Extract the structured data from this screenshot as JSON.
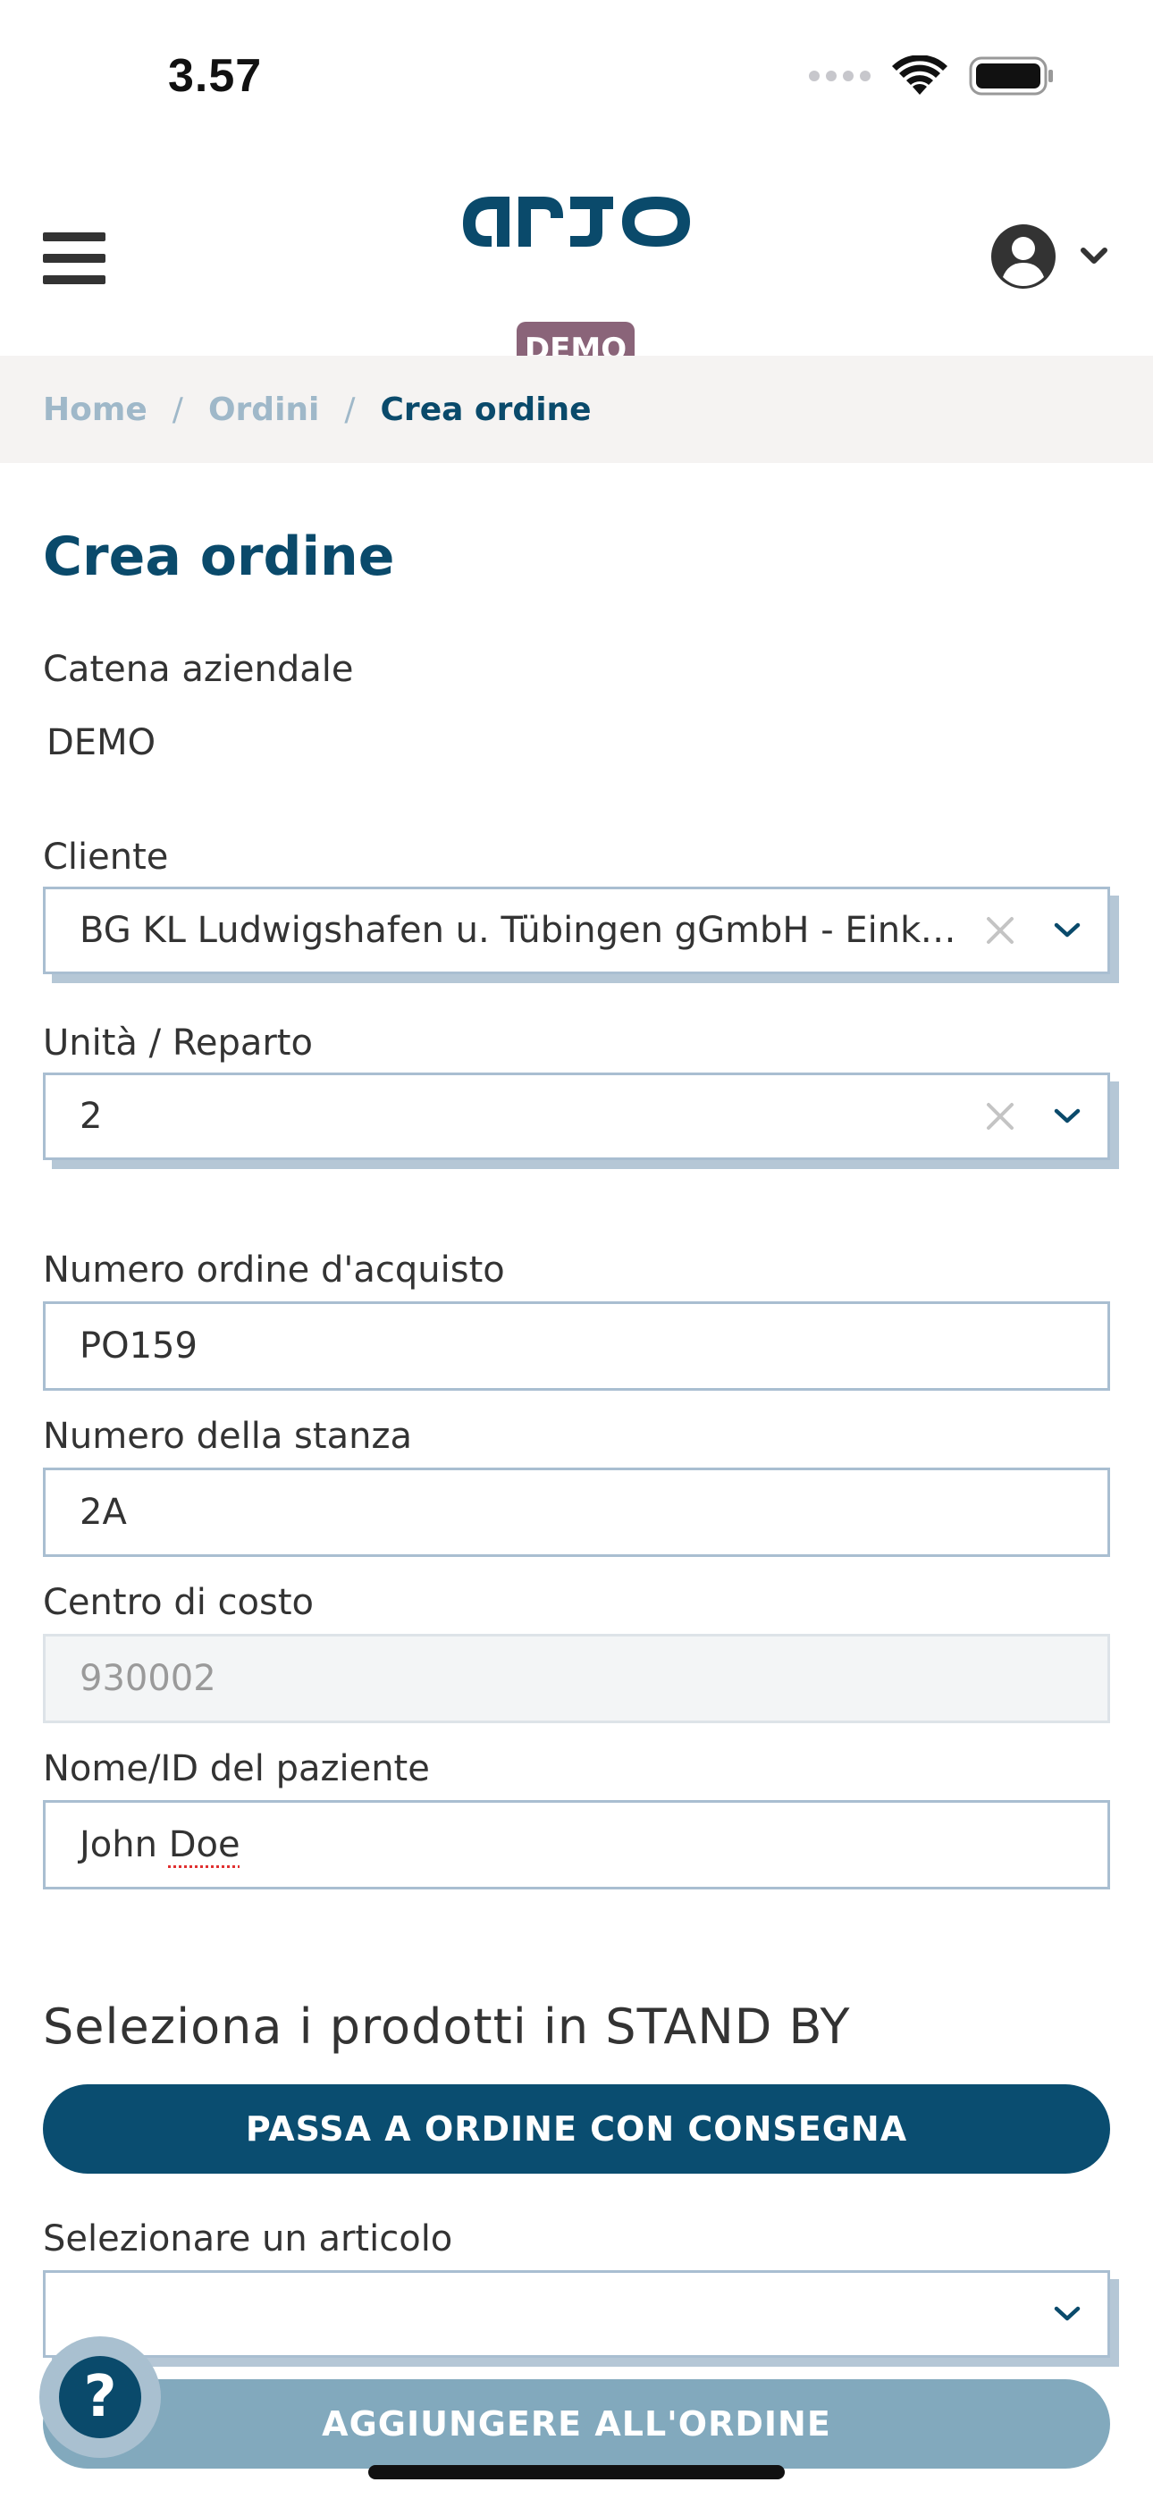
{
  "status_bar": {
    "time": "3.57"
  },
  "header": {
    "badge": "DEMO",
    "colors": {
      "brand": "#0a4a6b",
      "badge": "#8a6479"
    }
  },
  "breadcrumb": {
    "home": "Home",
    "orders": "Ordini",
    "current": "Crea ordine",
    "separator": "/"
  },
  "page": {
    "title": "Crea ordine"
  },
  "form": {
    "company_chain": {
      "label": "Catena aziendale",
      "value": "DEMO"
    },
    "customer": {
      "label": "Cliente",
      "value": "BG KL Ludwigshafen u. Tübingen gGmbH - Einkauf - ..."
    },
    "unit": {
      "label": "Unità / Reparto",
      "value": "2"
    },
    "po_number": {
      "label": "Numero ordine d'acquisto",
      "value": "PO159"
    },
    "room_number": {
      "label": "Numero della stanza",
      "value": "2A"
    },
    "cost_center": {
      "label": "Centro di costo",
      "value": "930002"
    },
    "patient": {
      "label": "Nome/ID del paziente",
      "first": "John",
      "last": "Doe"
    }
  },
  "standby": {
    "title": "Seleziona i prodotti in STAND BY",
    "switch_button": "PASSA A ORDINE CON CONSEGNA",
    "article_label": "Selezionare un articolo",
    "article_value": "",
    "add_button": "AGGIUNGERE ALL'ORDINE"
  },
  "help": {
    "glyph": "?"
  }
}
